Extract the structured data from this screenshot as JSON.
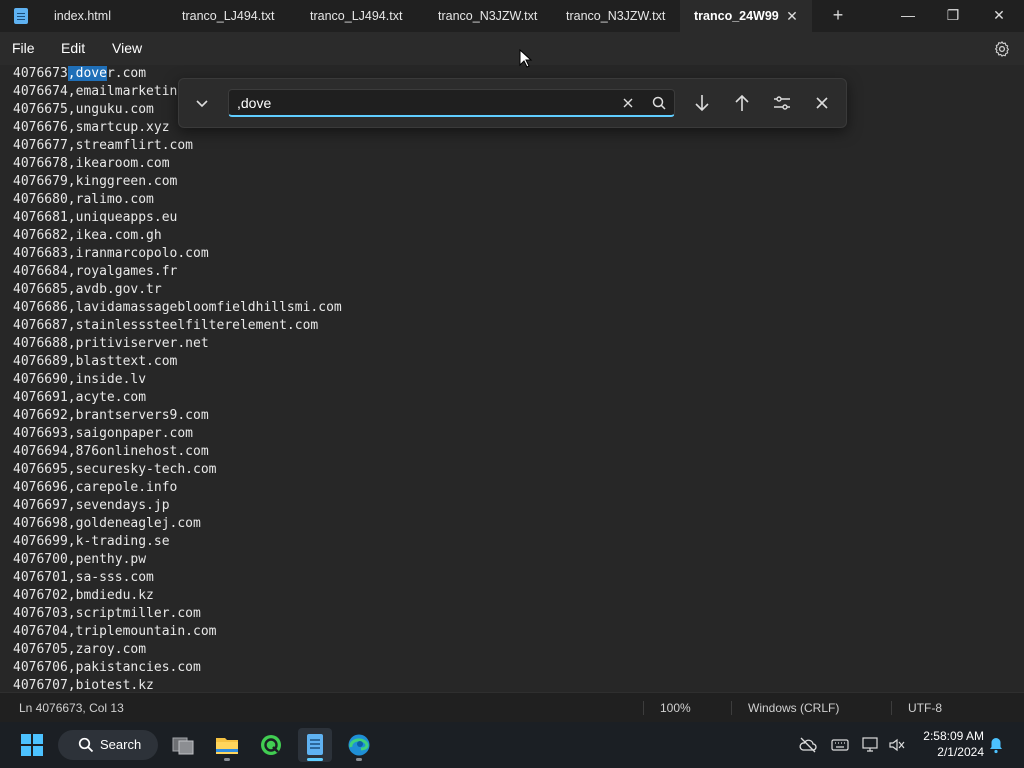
{
  "tabs": [
    {
      "label": "index.html"
    },
    {
      "label": "tranco_LJ494.txt"
    },
    {
      "label": "tranco_LJ494.txt"
    },
    {
      "label": "tranco_N3JZW.txt"
    },
    {
      "label": "tranco_N3JZW.txt"
    },
    {
      "label": "tranco_24W99",
      "active": true
    }
  ],
  "menu": {
    "file": "File",
    "edit": "Edit",
    "view": "View"
  },
  "find": {
    "query": ",dove"
  },
  "editor": {
    "first_line": {
      "prefix": "4076673",
      "selected": ",dove",
      "suffix": "r.com"
    },
    "lines": [
      "4076674,emailmarketin",
      "4076675,unguku.com",
      "4076676,smartcup.xyz",
      "4076677,streamflirt.com",
      "4076678,ikearoom.com",
      "4076679,kinggreen.com",
      "4076680,ralimo.com",
      "4076681,uniqueapps.eu",
      "4076682,ikea.com.gh",
      "4076683,iranmarcopolo.com",
      "4076684,royalgames.fr",
      "4076685,avdb.gov.tr",
      "4076686,lavidamassagebloomfieldhillsmi.com",
      "4076687,stainlesssteelfilterelement.com",
      "4076688,pritiviserver.net",
      "4076689,blasttext.com",
      "4076690,inside.lv",
      "4076691,acyte.com",
      "4076692,brantservers9.com",
      "4076693,saigonpaper.com",
      "4076694,876onlinehost.com",
      "4076695,securesky-tech.com",
      "4076696,carepole.info",
      "4076697,sevendays.jp",
      "4076698,goldeneaglej.com",
      "4076699,k-trading.se",
      "4076700,penthy.pw",
      "4076701,sa-sss.com",
      "4076702,bmdiedu.kz",
      "4076703,scriptmiller.com",
      "4076704,triplemountain.com",
      "4076705,zaroy.com",
      "4076706,pakistancies.com",
      "4076707,biotest.kz"
    ]
  },
  "status": {
    "position": "Ln 4076673, Col 13",
    "zoom": "100%",
    "line_ending": "Windows (CRLF)",
    "encoding": "UTF-8"
  },
  "taskbar": {
    "search_label": "Search",
    "time": "2:58:09 AM",
    "date": "2/1/2024"
  },
  "colors": {
    "accent": "#60cdff",
    "selection": "#1f6fb8"
  }
}
